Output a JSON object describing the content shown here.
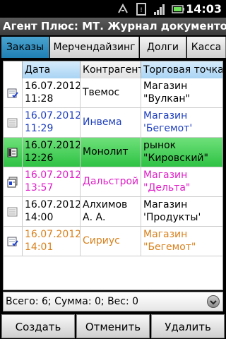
{
  "status_bar": {
    "time": "14:03",
    "icons": [
      "sync-icon",
      "sim-icon",
      "signal-icon",
      "battery-icon"
    ]
  },
  "title": "Агент Плюс: МТ. Журнал документов",
  "tabs": [
    {
      "label": "Заказы",
      "active": true
    },
    {
      "label": "Мерчендайзинг",
      "active": false
    },
    {
      "label": "Долги",
      "active": false
    },
    {
      "label": "Касса",
      "active": false
    }
  ],
  "table": {
    "headers": [
      "Дата",
      "Контрагент",
      "Торговая точка"
    ],
    "rows": [
      {
        "date": "16.07.2012",
        "time": "11:28",
        "contractor": "Твемос",
        "outlet": "Магазин \"Вулкан\"",
        "color": "#000000",
        "selected": false,
        "icon": "doc-check-icon"
      },
      {
        "date": "16.07.2012",
        "time": "11:29",
        "contractor": "Инвема",
        "outlet": "Магазин 'Бегемот'",
        "color": "#1e3fbf",
        "selected": false,
        "icon": "doc-plain-icon"
      },
      {
        "date": "16.07.2012",
        "time": "12:26",
        "contractor": "Монолит",
        "outlet": "рынок \"Кировский\"",
        "color": "#000000",
        "selected": true,
        "icon": "doc-dark-icon"
      },
      {
        "date": "16.07.2012",
        "time": "13:57",
        "contractor": "Дальстрой",
        "outlet": "Магазин \"Дельта\"",
        "color": "#e020c8",
        "selected": false,
        "icon": "doc-stack-icon"
      },
      {
        "date": "16.07.2012",
        "time": "14:00",
        "contractor": "Алхимов А. А.",
        "outlet": "Магазин 'Продукты'",
        "color": "#000000",
        "selected": false,
        "icon": "doc-plain-icon"
      },
      {
        "date": "16.07.2012",
        "time": "14:01",
        "contractor": "Сириус",
        "outlet": "Магазин \"Бегемот\"",
        "color": "#d9821e",
        "selected": false,
        "icon": "doc-check-icon"
      }
    ]
  },
  "summary": "Всего: 6; Сумма: 0; Вес: 0",
  "buttons": {
    "create": "Создать",
    "cancel": "Отменить",
    "delete": "Удалить"
  },
  "colors": {
    "active_tab": "#2a8cc1",
    "selected_row": "#3bcf50",
    "header_blue": "#b8dcf6"
  }
}
